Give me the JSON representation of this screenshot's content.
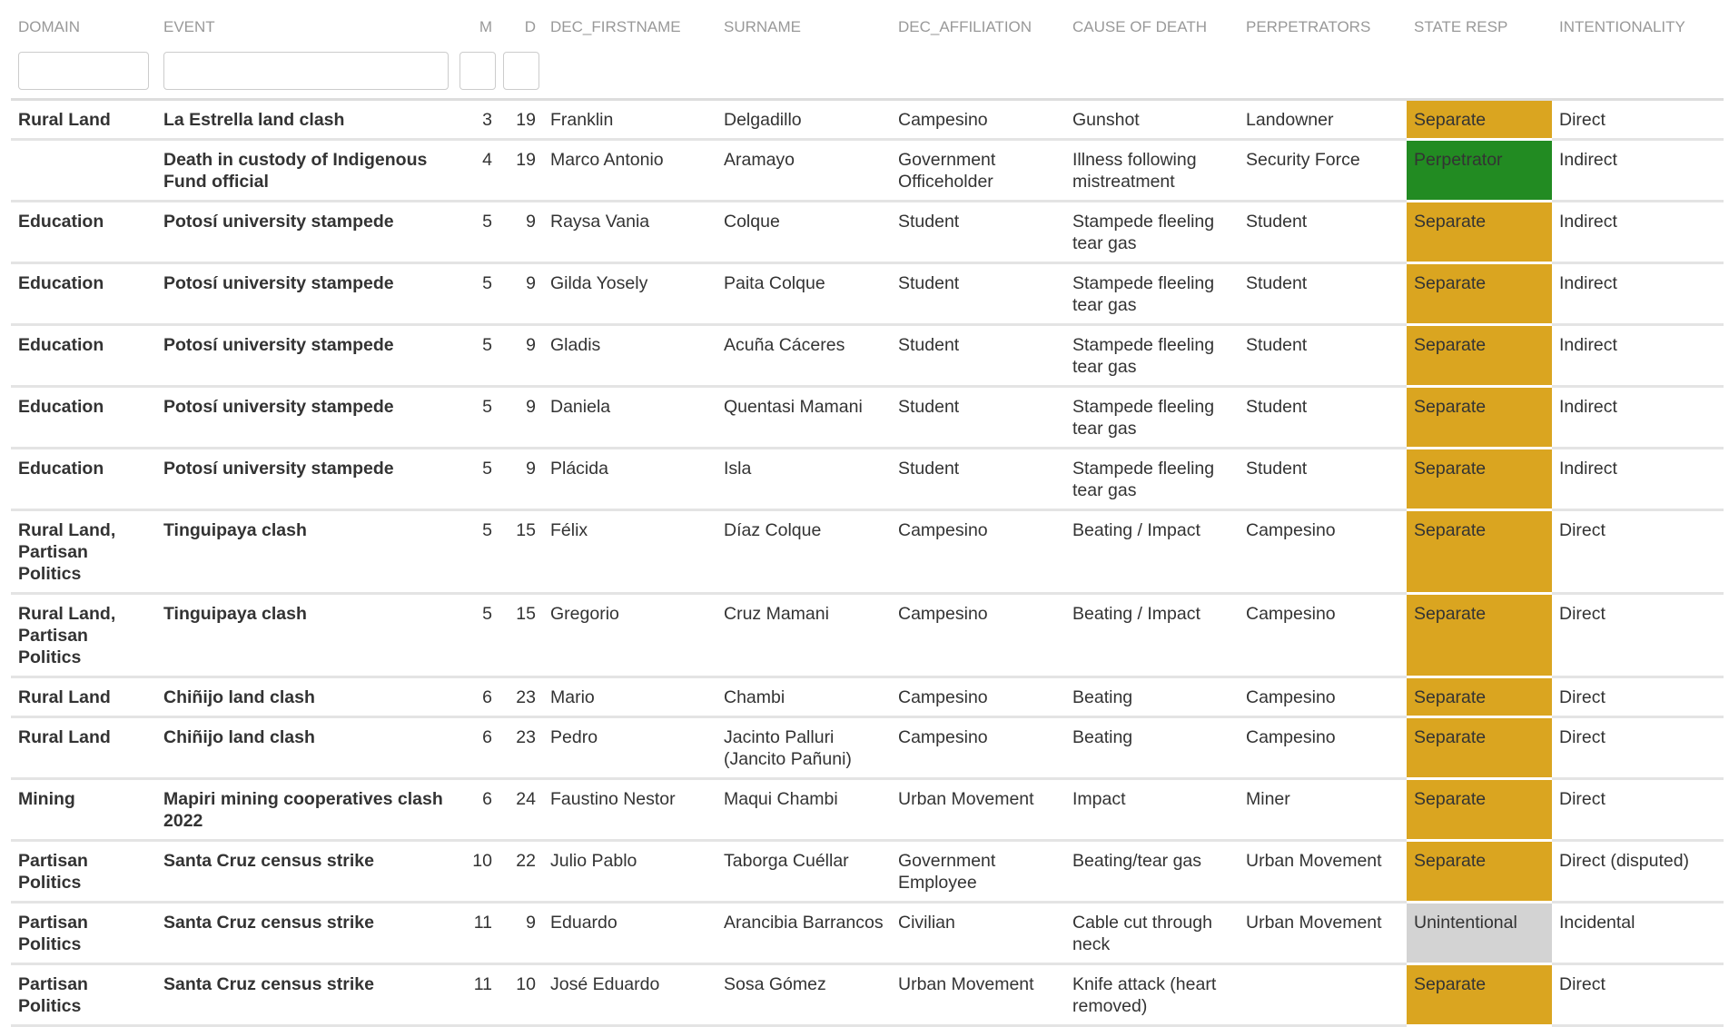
{
  "columns": [
    "DOMAIN",
    "EVENT",
    "M",
    "D",
    "DEC_FIRSTNAME",
    "SURNAME",
    "DEC_AFFILIATION",
    "CAUSE OF DEATH",
    "PERPETRATORS",
    "STATE RESP",
    "INTENTIONALITY"
  ],
  "filters": {
    "domain": "",
    "event": "",
    "m": "",
    "d": ""
  },
  "state_colors": {
    "Separate": "#DAA520",
    "Perpetrator": "#228B22",
    "Unintentional": "#D3D3D3"
  },
  "rows": [
    [
      "Rural Land",
      "La Estrella land clash",
      "3",
      "19",
      "Franklin",
      "Delgadillo",
      "Campesino",
      "Gunshot",
      "Landowner",
      "Separate",
      "Direct"
    ],
    [
      "",
      "Death in custody of Indigenous Fund official",
      "4",
      "19",
      "Marco Antonio",
      "Aramayo",
      "Government Officeholder",
      "Illness following mistreatment",
      "Security Force",
      "Perpetrator",
      "Indirect"
    ],
    [
      "Education",
      "Potosí university stampede",
      "5",
      "9",
      "Raysa Vania",
      "Colque",
      "Student",
      "Stampede fleeling tear gas",
      "Student",
      "Separate",
      "Indirect"
    ],
    [
      "Education",
      "Potosí university stampede",
      "5",
      "9",
      "Gilda Yosely",
      "Paita Colque",
      "Student",
      "Stampede fleeling tear gas",
      "Student",
      "Separate",
      "Indirect"
    ],
    [
      "Education",
      "Potosí university stampede",
      "5",
      "9",
      "Gladis",
      "Acuña Cáceres",
      "Student",
      "Stampede fleeling tear gas",
      "Student",
      "Separate",
      "Indirect"
    ],
    [
      "Education",
      "Potosí university stampede",
      "5",
      "9",
      "Daniela",
      "Quentasi Mamani",
      "Student",
      "Stampede fleeling tear gas",
      "Student",
      "Separate",
      "Indirect"
    ],
    [
      "Education",
      "Potosí university stampede",
      "5",
      "9",
      "Plácida",
      "Isla",
      "Student",
      "Stampede fleeling tear gas",
      "Student",
      "Separate",
      "Indirect"
    ],
    [
      "Rural Land, Partisan Politics",
      "Tinguipaya clash",
      "5",
      "15",
      "Félix",
      "Díaz Colque",
      "Campesino",
      "Beating / Impact",
      "Campesino",
      "Separate",
      "Direct"
    ],
    [
      "Rural Land, Partisan Politics",
      "Tinguipaya clash",
      "5",
      "15",
      "Gregorio",
      "Cruz Mamani",
      "Campesino",
      "Beating / Impact",
      "Campesino",
      "Separate",
      "Direct"
    ],
    [
      "Rural Land",
      "Chiñijo land clash",
      "6",
      "23",
      "Mario",
      "Chambi",
      "Campesino",
      "Beating",
      "Campesino",
      "Separate",
      "Direct"
    ],
    [
      "Rural Land",
      "Chiñijo land clash",
      "6",
      "23",
      "Pedro",
      "Jacinto Palluri (Jancito Pañuni)",
      "Campesino",
      "Beating",
      "Campesino",
      "Separate",
      "Direct"
    ],
    [
      "Mining",
      "Mapiri mining cooperatives clash 2022",
      "6",
      "24",
      "Faustino Nestor",
      "Maqui Chambi",
      "Urban Movement",
      "Impact",
      "Miner",
      "Separate",
      "Direct"
    ],
    [
      "Partisan Politics",
      "Santa Cruz census strike",
      "10",
      "22",
      "Julio Pablo",
      "Taborga Cuéllar",
      "Government Employee",
      "Beating/tear gas",
      "Urban Movement",
      "Separate",
      "Direct (disputed)"
    ],
    [
      "Partisan Politics",
      "Santa Cruz census strike",
      "11",
      "9",
      "Eduardo",
      "Arancibia Barrancos",
      "Civilian",
      "Cable cut through neck",
      "Urban Movement",
      "Unintentional",
      "Incidental"
    ],
    [
      "Partisan Politics",
      "Santa Cruz census strike",
      "11",
      "10",
      "José Eduardo",
      "Sosa Gómez",
      "Urban Movement",
      "Knife attack (heart removed)",
      "",
      "Separate",
      "Direct"
    ]
  ]
}
